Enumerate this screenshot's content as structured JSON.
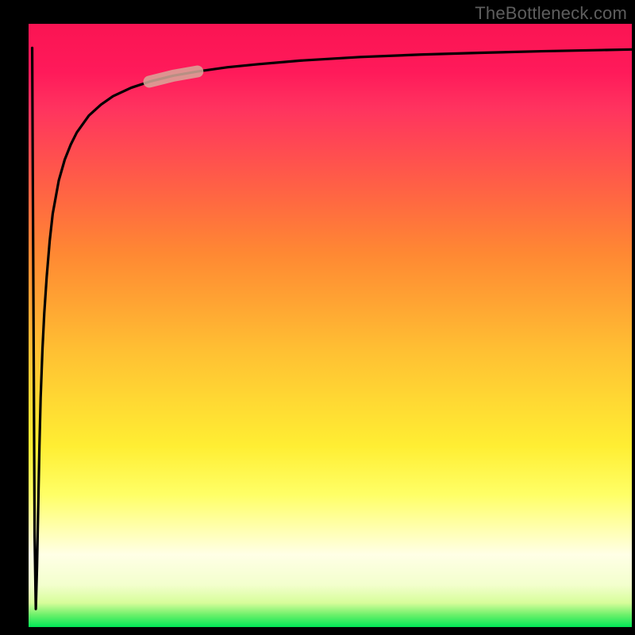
{
  "attribution": "TheBottleneck.com",
  "colors": {
    "curve": "#000000",
    "highlight": "#d8a89a"
  },
  "chart_data": {
    "type": "line",
    "title": "",
    "xlabel": "",
    "ylabel": "",
    "xlim": [
      0,
      100
    ],
    "ylim": [
      0,
      100
    ],
    "series": [
      {
        "name": "curve",
        "x": [
          0.6,
          0.7,
          0.8,
          0.9,
          1.0,
          1.2,
          1.4,
          1.6,
          1.8,
          2.0,
          2.3,
          2.6,
          3.0,
          3.5,
          4.0,
          5.0,
          6.0,
          7.0,
          8.0,
          10.0,
          12.0,
          14.0,
          17.0,
          20.0,
          24.0,
          28.0,
          33.0,
          38.0,
          45.0,
          55.0,
          65.0,
          75.0,
          85.0,
          95.0,
          100.0
        ],
        "y": [
          96.0,
          75.0,
          55.0,
          35.0,
          15.0,
          3.0,
          10.0,
          20.0,
          30.0,
          38.0,
          46.0,
          52.0,
          58.0,
          64.0,
          68.5,
          74.0,
          77.5,
          80.0,
          82.0,
          84.8,
          86.6,
          88.0,
          89.4,
          90.4,
          91.4,
          92.1,
          92.8,
          93.3,
          93.9,
          94.5,
          94.9,
          95.2,
          95.45,
          95.65,
          95.75
        ]
      }
    ],
    "highlight_segment": {
      "x_start": 20,
      "x_end": 28,
      "note": "pale pill-shaped marker on curve"
    },
    "background_gradient": {
      "bottom": "#00e756",
      "lower_mid": "#ffff66",
      "upper_mid": "#ff8833",
      "top": "#fa1453"
    }
  }
}
